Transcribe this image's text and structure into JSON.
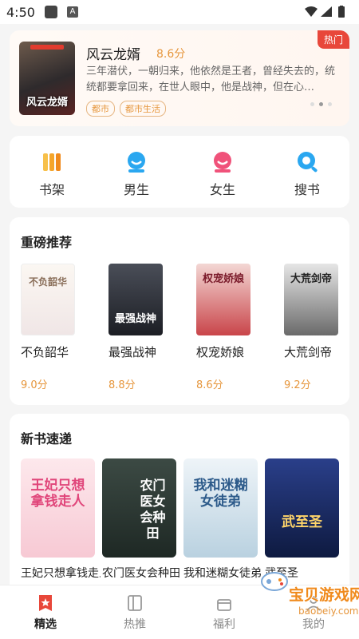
{
  "status": {
    "time": "4:50"
  },
  "hero": {
    "badge": "热门",
    "title": "风云龙婿",
    "score": "8.6分",
    "description": "三年潜伏，一朝归来，他依然是王者，曾经失去的，统统都要拿回来，在世人眼中，他是战神，但在心…",
    "cover_text": "风云龙婿",
    "tags": [
      "都市",
      "都市生活"
    ]
  },
  "nav": {
    "items": [
      {
        "label": "书架",
        "icon": "bookshelf-icon",
        "color": "#f5a52a"
      },
      {
        "label": "男生",
        "icon": "male-user-icon",
        "color": "#2aa7f0"
      },
      {
        "label": "女生",
        "icon": "female-user-icon",
        "color": "#f0527a"
      },
      {
        "label": "搜书",
        "icon": "search-icon",
        "color": "#2aa7f0"
      }
    ]
  },
  "recommend": {
    "title": "重磅推荐",
    "books": [
      {
        "name": "不负韶华",
        "score": "9.0分",
        "cover_text": "不负韶华"
      },
      {
        "name": "最强战神",
        "score": "8.8分",
        "cover_text": "最强战神"
      },
      {
        "name": "权宠娇娘",
        "score": "8.6分",
        "cover_text": "权宠娇娘"
      },
      {
        "name": "大荒剑帝",
        "score": "9.2分",
        "cover_text": "大荒剑帝"
      }
    ]
  },
  "new_books": {
    "title": "新书速递",
    "books": [
      {
        "name": "王妃只想拿钱走人",
        "cover_text": "王妃只想拿钱走人"
      },
      {
        "name": "农门医女会种田",
        "cover_text": "农门医女会种田"
      },
      {
        "name": "我和迷糊女徒弟",
        "cover_text": "我和迷糊女徒弟"
      },
      {
        "name": "武至圣",
        "cover_text": "武至圣"
      }
    ]
  },
  "tabs": [
    {
      "label": "精选",
      "icon": "featured-icon",
      "active": true
    },
    {
      "label": "热推",
      "icon": "hot-book-icon",
      "active": false
    },
    {
      "label": "福利",
      "icon": "gift-icon",
      "active": false
    },
    {
      "label": "我的",
      "icon": "profile-icon",
      "active": false
    }
  ],
  "watermark": {
    "text": "宝贝游戏网",
    "url_text": "baobeiy.com"
  },
  "colors": {
    "accent": "#e6963c",
    "hot": "#e8473a",
    "active_tab": "#e8473a"
  }
}
